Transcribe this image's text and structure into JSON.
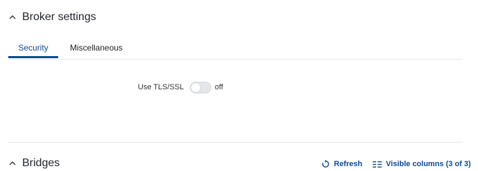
{
  "broker_settings": {
    "title": "Broker settings",
    "tabs": [
      {
        "label": "Security",
        "active": true
      },
      {
        "label": "Miscellaneous",
        "active": false
      }
    ],
    "tls": {
      "label": "Use TLS/SSL",
      "state": "off",
      "enabled": false
    }
  },
  "bridges": {
    "title": "Bridges",
    "refresh_label": "Refresh",
    "visible_columns_label": "Visible columns (3 of 3)"
  },
  "colors": {
    "accent": "#0e4a92",
    "toggle_off": "#e4e6e9",
    "divider": "#e6e8eb"
  }
}
